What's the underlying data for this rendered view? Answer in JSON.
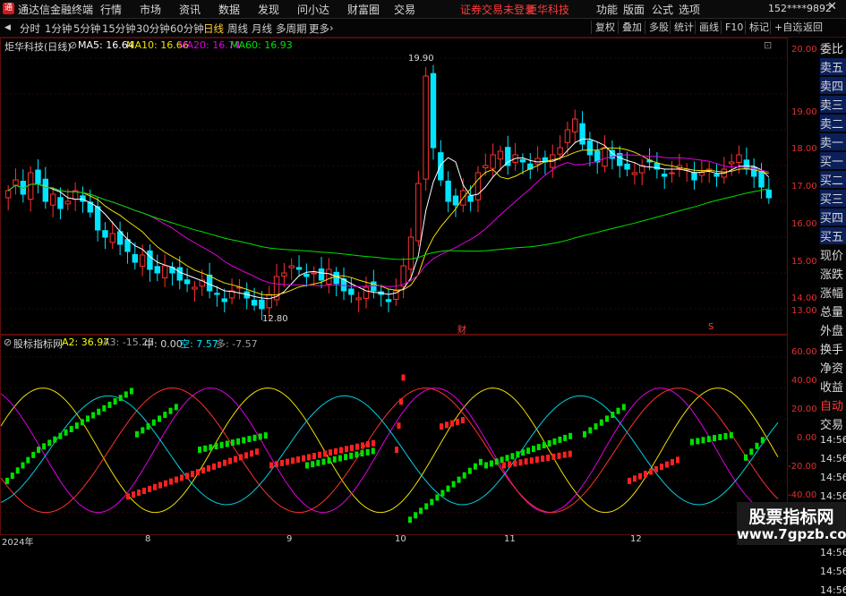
{
  "menubar": {
    "app_title": "通达信金融终端",
    "items": [
      "行情",
      "市场",
      "资讯",
      "数据",
      "发现",
      "问小达",
      "财富圈",
      "交易"
    ],
    "notice": "证券交易未登录",
    "notice_stock": "炬华科技",
    "right_items": [
      "功能",
      "版面",
      "公式",
      "选项"
    ],
    "user": "152****9892"
  },
  "toolbar": {
    "periods": [
      "分时",
      "1分钟",
      "5分钟",
      "15分钟",
      "30分钟",
      "60分钟",
      "日线",
      "周线",
      "月线",
      "多周期",
      "更多"
    ],
    "active_period": "日线",
    "buttons": [
      "复权",
      "叠加",
      "多股",
      "统计",
      "画线",
      "F10",
      "+自选",
      "返回"
    ]
  },
  "main_chart": {
    "title": "炬华科技(日线)",
    "ma_labels": [
      "MA5: 16.64",
      "MA10: 16.66",
      "MA20: 16.74",
      "MA60: 16.93"
    ],
    "high_label": "19.90",
    "low_label": "12.80",
    "event_labels": [
      "财",
      "S"
    ],
    "y_axis": [
      "20.00",
      "19.00",
      "18.00",
      "17.00",
      "16.00",
      "15.00",
      "14.00",
      "13.00"
    ]
  },
  "sub_chart": {
    "title": "股标指标网",
    "legend": [
      "A2: 36.97",
      "A3: -15.27",
      "中: 0.00",
      "空: 7.57",
      "多: -7.57"
    ],
    "y_axis": [
      "60.00",
      "40.00",
      "20.00",
      "0.00",
      "-20.00",
      "-40.00"
    ]
  },
  "time_axis": [
    "2024年",
    "8",
    "9",
    "10",
    "11",
    "12"
  ],
  "side_panel": {
    "items": [
      "委比",
      "卖五",
      "卖四",
      "卖三",
      "卖二",
      "卖一",
      "买一",
      "买二",
      "买三",
      "买四",
      "买五",
      "现价",
      "涨跌",
      "涨幅",
      "总量",
      "外盘",
      "换手",
      "净资",
      "收益",
      "自动",
      "交易",
      "14:56",
      "14:56",
      "14:56",
      "14:56",
      "14:56",
      "14:56",
      "14:56",
      "14:56",
      "14:56"
    ]
  },
  "watermark": {
    "line1": "股票指标网",
    "line2": "www.7gpzb.com"
  },
  "colors": {
    "up": "#ff3030",
    "down": "#00e5ff",
    "ma5": "#ffffff",
    "ma10": "#f0e000",
    "ma20": "#e000e0",
    "ma60": "#00e000",
    "axis": "#e03030"
  },
  "chart_data": [
    {
      "type": "candlestick",
      "title": "炬华科技(日线)",
      "y_range": [
        12.6,
        20.2
      ],
      "x_labels": [
        "2024年",
        "8",
        "9",
        "10",
        "11",
        "12"
      ],
      "close": [
        16.3,
        16.6,
        16.2,
        16.8,
        16.5,
        16.0,
        16.2,
        15.8,
        16.0,
        16.3,
        16.0,
        15.7,
        15.2,
        15.0,
        15.1,
        14.8,
        14.6,
        14.3,
        14.5,
        14.1,
        14.0,
        14.2,
        14.0,
        13.8,
        13.7,
        13.6,
        13.8,
        13.5,
        13.4,
        13.2,
        13.5,
        13.6,
        13.3,
        13.1,
        13.0,
        13.4,
        13.9,
        14.0,
        14.2,
        14.1,
        13.9,
        14.0,
        13.8,
        14.1,
        13.7,
        13.5,
        13.4,
        13.3,
        13.6,
        13.5,
        13.4,
        13.2,
        13.5,
        14.2,
        15.0,
        16.5,
        19.5,
        17.5,
        16.6,
        16.0,
        15.9,
        16.3,
        16.0,
        16.8,
        17.0,
        17.3,
        17.4,
        17.0,
        17.3,
        17.1,
        16.9,
        17.2,
        17.1,
        17.3,
        17.5,
        18.0,
        18.3,
        17.6,
        17.3,
        17.1,
        17.5,
        17.2,
        17.0,
        16.9,
        16.8,
        17.0,
        17.1,
        16.9,
        16.7,
        16.8,
        17.0,
        16.9,
        16.6,
        16.8,
        16.9,
        16.7,
        16.9,
        17.1,
        17.3,
        16.9,
        16.7,
        16.4,
        16.1
      ],
      "low_point": 12.8,
      "high_point": 19.9,
      "ma": [
        {
          "name": "MA5",
          "last": 16.64
        },
        {
          "name": "MA10",
          "last": 16.66
        },
        {
          "name": "MA20",
          "last": 16.74
        },
        {
          "name": "MA60",
          "last": 16.93
        }
      ]
    },
    {
      "type": "line",
      "title": "股标指标网",
      "y_range": [
        -50,
        68
      ],
      "series": [
        {
          "name": "A2",
          "last": 36.97
        },
        {
          "name": "A3",
          "last": -15.27
        },
        {
          "name": "中",
          "last": 0.0
        },
        {
          "name": "空",
          "last": 7.57
        },
        {
          "name": "多",
          "last": -7.57
        }
      ]
    }
  ]
}
